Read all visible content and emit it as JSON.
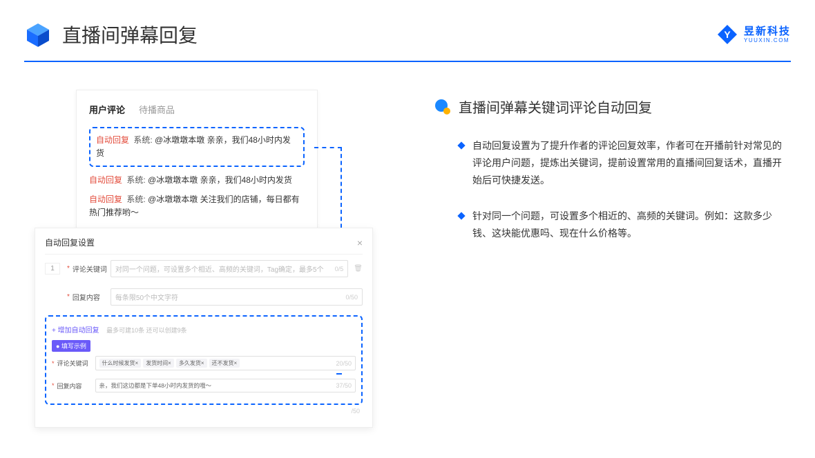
{
  "header": {
    "title": "直播间弹幕回复",
    "brand_cn": "昱新科技",
    "brand_en": "YUUXIN.COM"
  },
  "comments_panel": {
    "tab_active": "用户评论",
    "tab_inactive": "待播商品",
    "highlighted": "自动回复 系统: @冰墩墩本墩 亲亲，我们48小时内发货",
    "line2": "自动回复 系统: @冰墩墩本墩 亲亲，我们48小时内发货",
    "line3": "自动回复 系统: @冰墩墩本墩 关注我们的店铺，每日都有热门推荐哟～",
    "tag_auto": "自动回复",
    "tag_sys": "系统:",
    "user1": "@冰墩墩本墩 亲亲，我们48小时内发货",
    "user2": "@冰墩墩本墩 亲亲，我们48小时内发货",
    "user3": "@冰墩墩本墩 关注我们的店铺，每日都有热门推荐哟～"
  },
  "settings_panel": {
    "title": "自动回复设置",
    "row_num": "1",
    "label_keyword": "评论关键词",
    "placeholder_keyword": "对同一个问题，可设置多个相近、高频的关键词，Tag确定，最多5个",
    "counter_keyword": "0/5",
    "label_content": "回复内容",
    "placeholder_content": "每条限50个中文字符",
    "counter_content": "0/50",
    "add_link": "+ 增加自动回复",
    "add_hint": "最多可建10条 还可以创建9条",
    "example_tag": "● 填写示例",
    "ex_label_keyword": "评论关键词",
    "chips": [
      "什么时候发货×",
      "发货时间×",
      "多久发货×",
      "还不发货×"
    ],
    "ex_counter_keyword": "20/50",
    "ex_label_content": "回复内容",
    "ex_content": "亲，我们这边都是下单48小时内发货的哦～",
    "ex_counter_content": "37/50",
    "outer_counter": "/50"
  },
  "right": {
    "section_title": "直播间弹幕关键词评论自动回复",
    "bullet1": "自动回复设置为了提升作者的评论回复效率，作者可在开播前针对常见的评论用户问题，提炼出关键词，提前设置常用的直播间回复话术，直播开始后可快捷发送。",
    "bullet2": "针对同一个问题，可设置多个相近的、高频的关键词。例如：这款多少钱、这块能优惠吗、现在什么价格等。"
  }
}
